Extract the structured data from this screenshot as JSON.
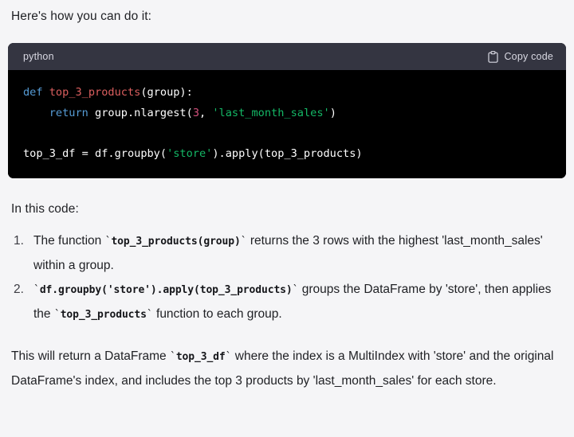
{
  "intro": {
    "text": "Here's how you can do it:"
  },
  "code_block": {
    "language": "python",
    "copy_label": "Copy code",
    "copy_icon": "clipboard-icon",
    "lines": [
      {
        "tokens": [
          {
            "t": "def ",
            "c": "kw"
          },
          {
            "t": "top_3_products",
            "c": "fn"
          },
          {
            "t": "(group):",
            "c": "plain"
          }
        ]
      },
      {
        "tokens": [
          {
            "t": "    ",
            "c": "plain"
          },
          {
            "t": "return",
            "c": "kw"
          },
          {
            "t": " group.nlargest(",
            "c": "plain"
          },
          {
            "t": "3",
            "c": "num"
          },
          {
            "t": ", ",
            "c": "plain"
          },
          {
            "t": "'last_month_sales'",
            "c": "str"
          },
          {
            "t": ")",
            "c": "plain"
          }
        ]
      },
      {
        "tokens": []
      },
      {
        "tokens": [
          {
            "t": "top_3_df = df.groupby(",
            "c": "plain"
          },
          {
            "t": "'store'",
            "c": "str"
          },
          {
            "t": ").apply(top_3_products)",
            "c": "plain"
          }
        ]
      }
    ],
    "colors": {
      "header_bg": "#343541",
      "body_bg": "#000000",
      "keyword": "#569cd6",
      "function": "#dc5f5f",
      "string": "#14b866",
      "number": "#d4517d",
      "text": "#ffffff"
    }
  },
  "section_label": {
    "text": "In this code:"
  },
  "steps": [
    {
      "parts": [
        {
          "t": "The function ",
          "k": "text"
        },
        {
          "t": "`",
          "k": "tick"
        },
        {
          "t": "top_3_products(group)",
          "k": "code"
        },
        {
          "t": "`",
          "k": "tick"
        },
        {
          "t": " returns the 3 rows with the highest 'last_month_sales' within a group.",
          "k": "text"
        }
      ]
    },
    {
      "parts": [
        {
          "t": "`",
          "k": "tick"
        },
        {
          "t": "df.groupby('store').apply(top_3_products)",
          "k": "code"
        },
        {
          "t": "`",
          "k": "tick"
        },
        {
          "t": " groups the DataFrame by 'store', then applies the ",
          "k": "text"
        },
        {
          "t": "`",
          "k": "tick"
        },
        {
          "t": "top_3_products",
          "k": "code"
        },
        {
          "t": "`",
          "k": "tick"
        },
        {
          "t": " function to each group.",
          "k": "text"
        }
      ]
    }
  ],
  "final_paragraph": {
    "parts": [
      {
        "t": "This will return a DataFrame ",
        "k": "text"
      },
      {
        "t": "`",
        "k": "tick"
      },
      {
        "t": "top_3_df",
        "k": "code"
      },
      {
        "t": "`",
        "k": "tick"
      },
      {
        "t": " where the index is a MultiIndex with 'store' and the original DataFrame's index, and includes the top 3 products by 'last_month_sales' for each store.",
        "k": "text"
      }
    ]
  },
  "theme": {
    "page_bg": "#f5f5f7",
    "text_color": "#1f2024"
  }
}
